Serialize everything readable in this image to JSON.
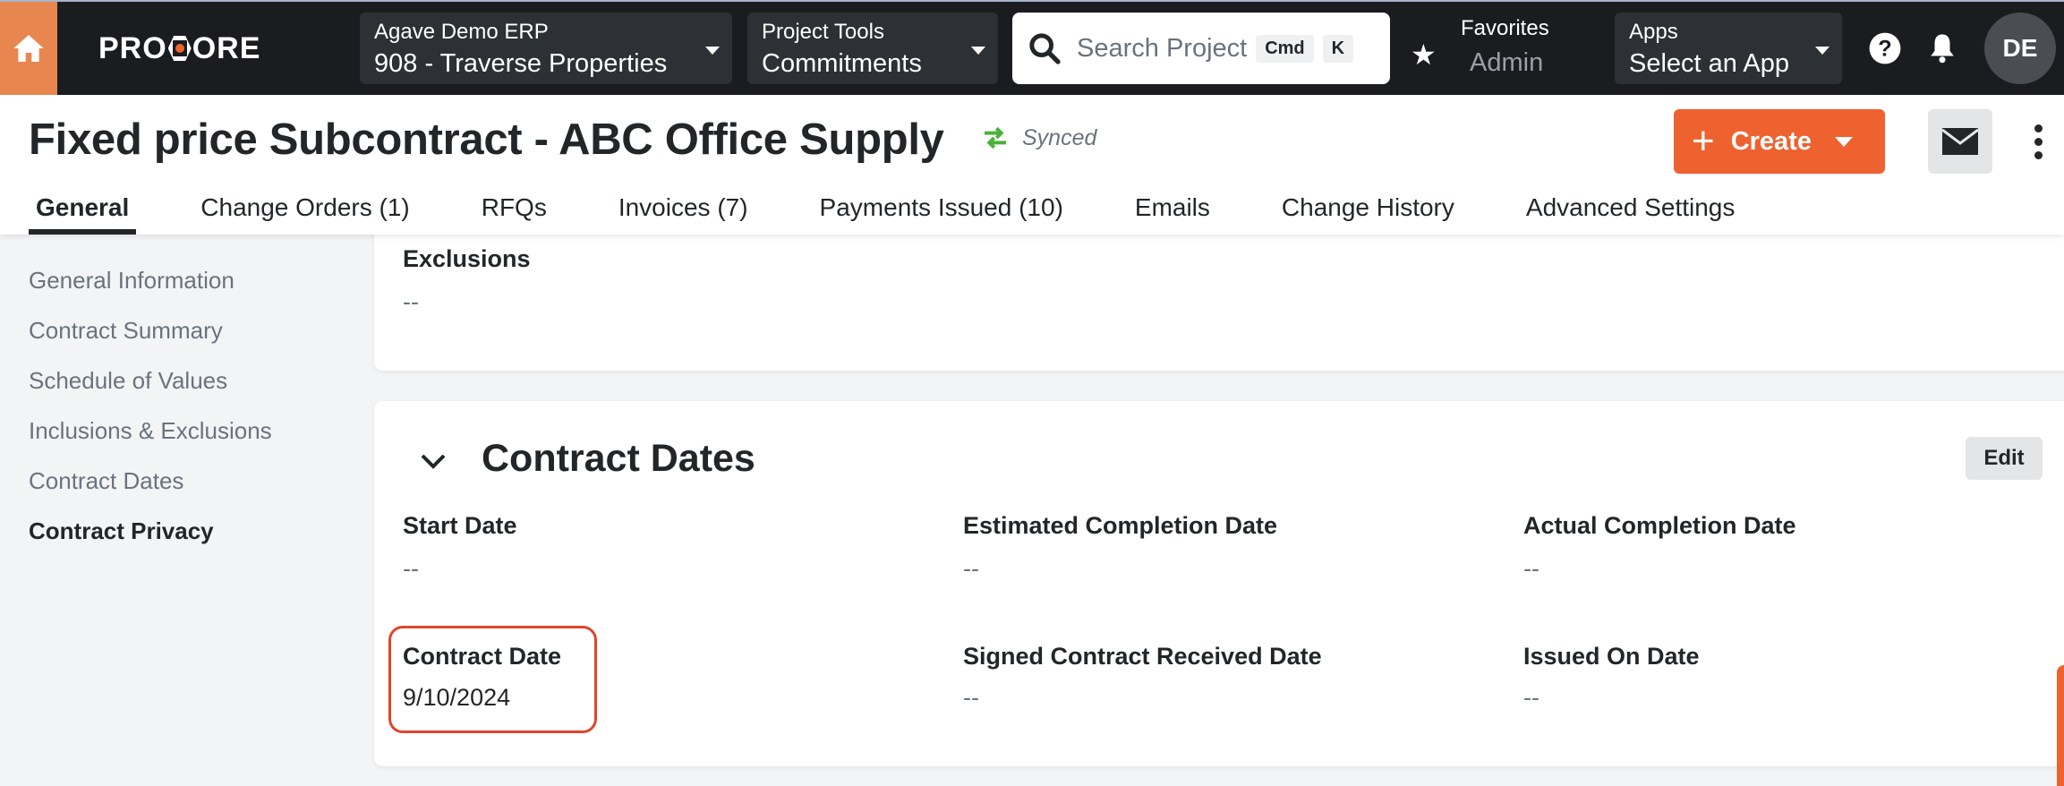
{
  "topbar": {
    "logo_text_pre": "PRO",
    "logo_text_post": "ORE",
    "company": {
      "label": "Agave Demo ERP",
      "value": "908 - Traverse Properties"
    },
    "tools": {
      "label": "Project Tools",
      "value": "Commitments"
    },
    "search": {
      "placeholder": "Search Project",
      "shortcut_1": "Cmd",
      "shortcut_2": "K"
    },
    "favorites": {
      "label": "Favorites",
      "value": "Admin"
    },
    "apps": {
      "label": "Apps",
      "value": "Select an App"
    },
    "avatar_initials": "DE",
    "colors": {
      "bar": "#1a1c20",
      "home": "#e8864f"
    }
  },
  "header": {
    "title": "Fixed price Subcontract - ABC Office Supply",
    "sync_status": "Synced",
    "create_label": "Create",
    "tabs": [
      {
        "label": "General",
        "active": true
      },
      {
        "label": "Change Orders (1)"
      },
      {
        "label": "RFQs"
      },
      {
        "label": "Invoices (7)"
      },
      {
        "label": "Payments Issued (10)"
      },
      {
        "label": "Emails"
      },
      {
        "label": "Change History"
      },
      {
        "label": "Advanced Settings"
      }
    ],
    "colors": {
      "accent": "#ee6230",
      "sync": "#4ab23a"
    }
  },
  "sidebar": {
    "items": [
      {
        "label": "General Information"
      },
      {
        "label": "Contract Summary"
      },
      {
        "label": "Schedule of Values"
      },
      {
        "label": "Inclusions & Exclusions"
      },
      {
        "label": "Contract Dates"
      },
      {
        "label": "Contract Privacy",
        "active": true
      }
    ]
  },
  "exclusions": {
    "label": "Exclusions",
    "value": "--"
  },
  "contract_dates": {
    "title": "Contract Dates",
    "edit_label": "Edit",
    "fields": [
      {
        "label": "Start Date",
        "value": "--"
      },
      {
        "label": "Estimated Completion Date",
        "value": "--"
      },
      {
        "label": "Actual Completion Date",
        "value": "--"
      },
      {
        "label": "Contract Date",
        "value": "9/10/2024",
        "highlighted": true
      },
      {
        "label": "Signed Contract Received Date",
        "value": "--"
      },
      {
        "label": "Issued On Date",
        "value": "--"
      }
    ],
    "highlight_color": "#e2452b"
  }
}
